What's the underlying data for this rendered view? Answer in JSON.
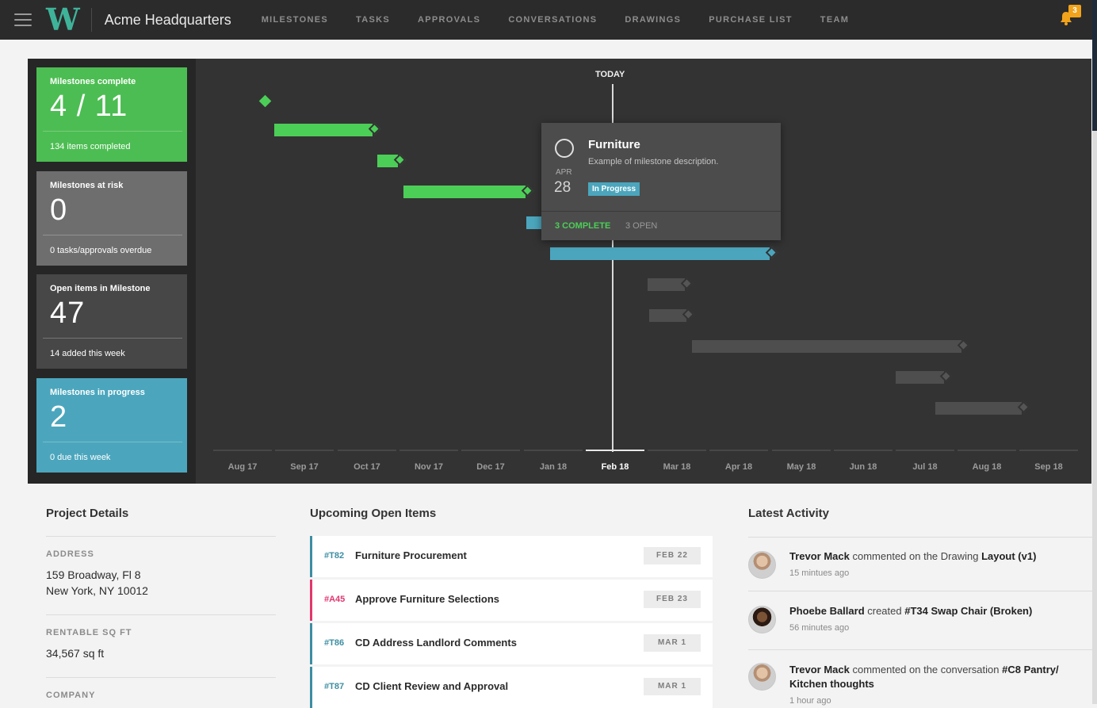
{
  "app": {
    "project_name": "Acme Headquarters",
    "logo_letter": "W",
    "notification_count": "3",
    "nav": [
      "MILESTONES",
      "TASKS",
      "APPROVALS",
      "CONVERSATIONS",
      "DRAWINGS",
      "PURCHASE LIST",
      "TEAM"
    ]
  },
  "stats": [
    {
      "title": "Milestones complete",
      "value": "4 / 11",
      "sub": "134 items completed",
      "color": "#4cbd52"
    },
    {
      "title": "Milestones at risk",
      "value": "0",
      "sub": "0 tasks/approvals overdue",
      "color": "#6e6e6e"
    },
    {
      "title": "Open items in Milestone",
      "value": "47",
      "sub": "14 added this week",
      "color": "#474747"
    },
    {
      "title": "Milestones in progress",
      "value": "2",
      "sub": "0 due this week",
      "color": "#4ba6bd"
    }
  ],
  "timeline": {
    "today_label": "TODAY",
    "months": [
      "Aug 17",
      "Sep 17",
      "Oct 17",
      "Nov 17",
      "Dec 17",
      "Jan 18",
      "Feb 18",
      "Mar 18",
      "Apr 18",
      "May 18",
      "Jun 18",
      "Jul 18",
      "Aug 18",
      "Sep 18"
    ],
    "current_month": "Feb 18"
  },
  "popup": {
    "title": "Furniture",
    "description": "Example of milestone description.",
    "month": "APR",
    "day": "28",
    "status": "In Progress",
    "complete": "3 COMPLETE",
    "open": "3 OPEN"
  },
  "details": {
    "title": "Project Details",
    "address_label": "ADDRESS",
    "address_line1": "159 Broadway, Fl 8",
    "address_line2": "New York, NY 10012",
    "sqft_label": "RENTABLE SQ FT",
    "sqft_value": "34,567 sq ft",
    "company_label": "COMPANY"
  },
  "upcoming": {
    "title": "Upcoming Open Items",
    "items": [
      {
        "id": "#T82",
        "name": "Furniture Procurement",
        "date": "FEB 22"
      },
      {
        "id": "#A45",
        "name": "Approve Furniture Selections",
        "date": "FEB 23"
      },
      {
        "id": "#T86",
        "name": "CD Address Landlord Comments",
        "date": "MAR 1"
      },
      {
        "id": "#T87",
        "name": "CD Client Review and Approval",
        "date": "MAR 1"
      }
    ]
  },
  "activity": {
    "title": "Latest Activity",
    "items": [
      {
        "user": "Trevor Mack",
        "action": " commented on the Drawing ",
        "target": "Layout (v1)",
        "time": "15 mintues ago"
      },
      {
        "user": "Phoebe Ballard",
        "action": " created ",
        "target": "#T34 Swap Chair (Broken)",
        "time": "56 minutes ago"
      },
      {
        "user": "Trevor Mack",
        "action": " commented on the conversation ",
        "target": "#C8 Pantry/ Kitchen thoughts",
        "time": "1 hour ago"
      }
    ]
  }
}
